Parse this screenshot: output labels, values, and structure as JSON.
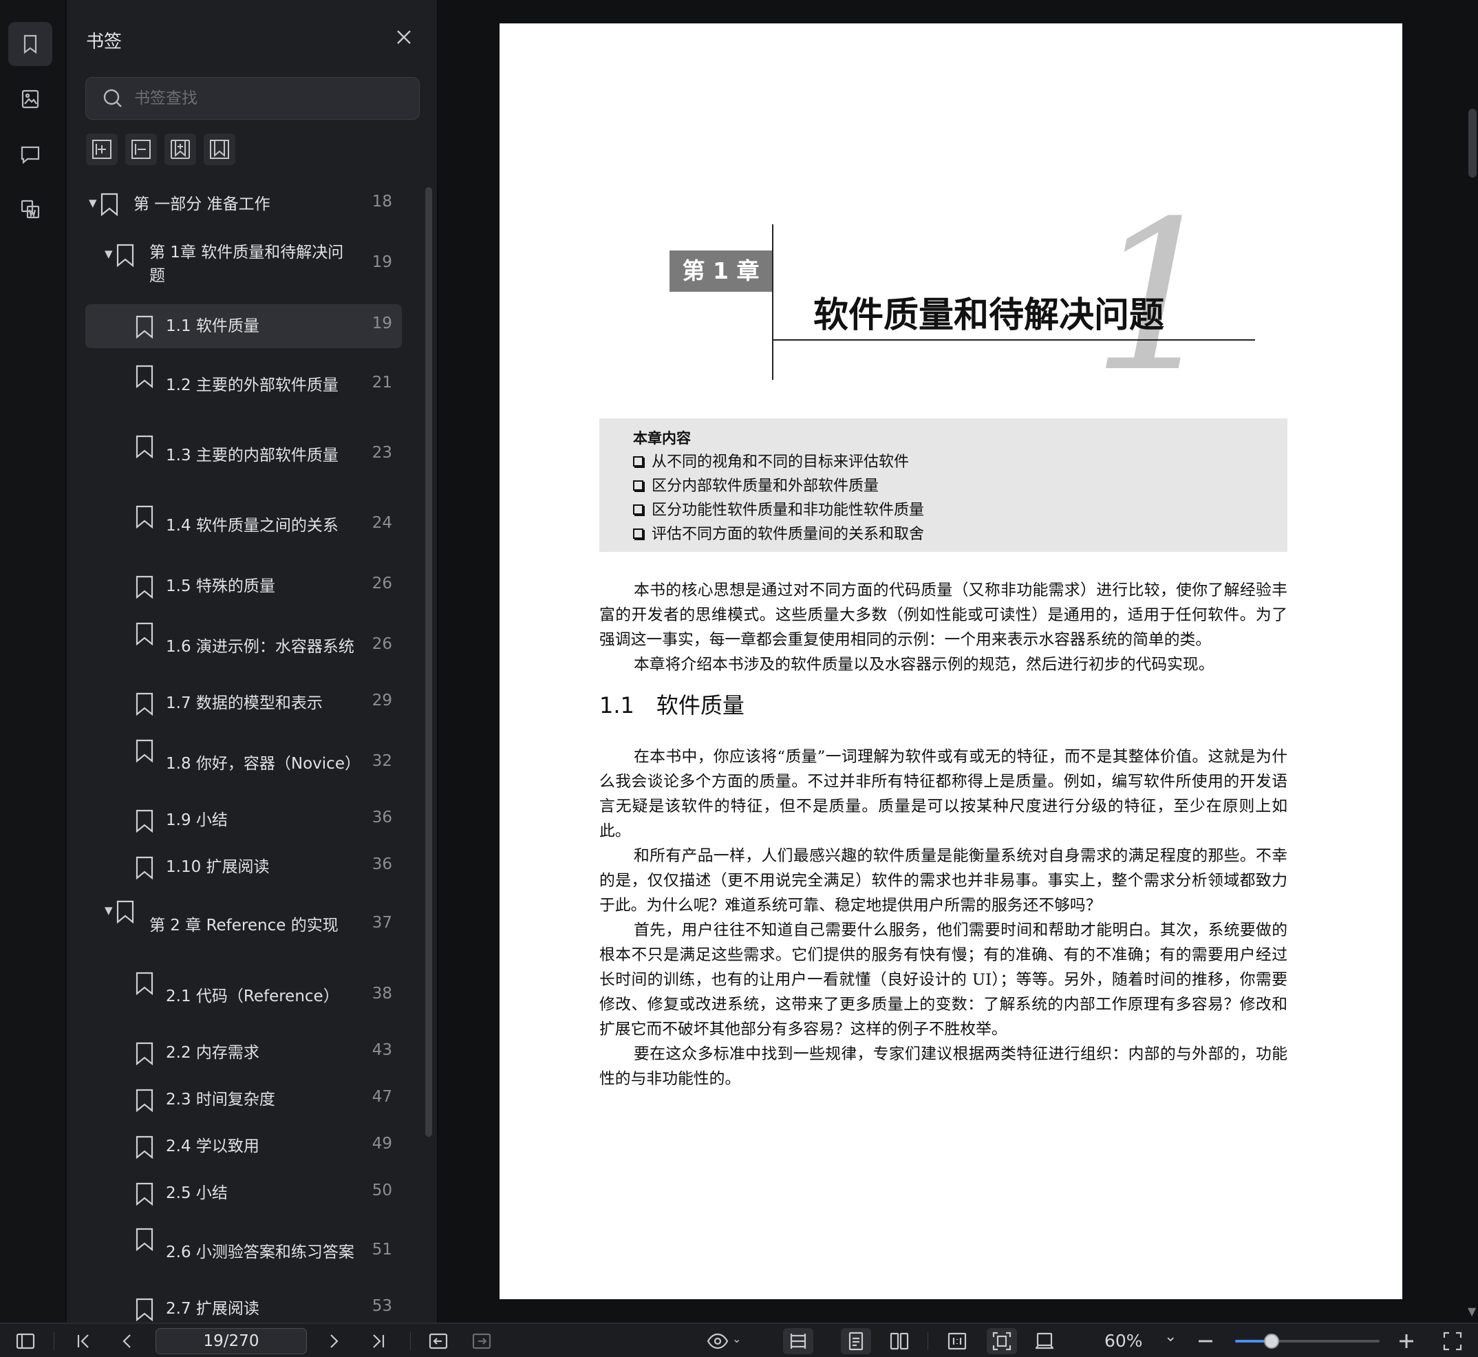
{
  "sidebar": {
    "title": "书签",
    "search_placeholder": "书签查找",
    "rail_icons": [
      "bookmark-icon",
      "image-icon",
      "comment-icon",
      "word-export-icon"
    ],
    "toolbar_icons": [
      "add-bookmark-icon",
      "remove-bookmark-icon",
      "add-child-bookmark-icon",
      "bookmark-icon"
    ],
    "items": [
      {
        "label": "第 一部分 准备工作",
        "page": "18",
        "level": 0,
        "expanded": true
      },
      {
        "label": "第 1章 软件质量和待解决问",
        "label2": "题",
        "page": "19",
        "level": 1,
        "expanded": true
      },
      {
        "label": "1.1 软件质量",
        "page": "19",
        "level": 2,
        "selected": true
      },
      {
        "label": "1.2 主要的外部软件质量",
        "page": "21",
        "level": 2
      },
      {
        "label": "1.3 主要的内部软件质量",
        "page": "23",
        "level": 2
      },
      {
        "label": "1.4 软件质量之间的关系",
        "page": "24",
        "level": 2
      },
      {
        "label": "1.5 特殊的质量",
        "page": "26",
        "level": 2
      },
      {
        "label": "1.6 演进示例：水容器系统",
        "page": "26",
        "level": 2
      },
      {
        "label": "1.7 数据的模型和表示",
        "page": "29",
        "level": 2
      },
      {
        "label": "1.8 你好，容器（Novice）",
        "page": "32",
        "level": 2
      },
      {
        "label": "1.9 小结",
        "page": "36",
        "level": 2
      },
      {
        "label": "1.10 扩展阅读",
        "page": "36",
        "level": 2
      },
      {
        "label": "第 2 章 Reference 的实现",
        "page": "37",
        "level": 1,
        "expanded": true
      },
      {
        "label": "2.1 代码（Reference）",
        "page": "38",
        "level": 2
      },
      {
        "label": "2.2 内存需求",
        "page": "43",
        "level": 2
      },
      {
        "label": "2.3 时间复杂度",
        "page": "47",
        "level": 2
      },
      {
        "label": "2.4 学以致用",
        "page": "49",
        "level": 2
      },
      {
        "label": "2.5 小结",
        "page": "50",
        "level": 2
      },
      {
        "label": "2.6 小测验答案和练习答案",
        "page": "51",
        "level": 2
      },
      {
        "label": "2.7 扩展阅读",
        "page": "53",
        "level": 2
      }
    ]
  },
  "document": {
    "chapter_badge": "第 1 章",
    "chapter_number": "1",
    "chapter_title": "软件质量和待解决问题",
    "contents_heading": "本章内容",
    "contents_items": [
      "从不同的视角和不同的目标来评估软件",
      "区分内部软件质量和外部软件质量",
      "区分功能性软件质量和非功能性软件质量",
      "评估不同方面的软件质量间的关系和取舍"
    ],
    "intro_paragraphs": [
      "本书的核心思想是通过对不同方面的代码质量（又称非功能需求）进行比较，使你了解经验丰富的开发者的思维模式。这些质量大多数（例如性能或可读性）是通用的，适用于任何软件。为了强调这一事实，每一章都会重复使用相同的示例：一个用来表示水容器系统的简单的类。",
      "本章将介绍本书涉及的软件质量以及水容器示例的规范，然后进行初步的代码实现。"
    ],
    "section_number": "1.1",
    "section_title": "软件质量",
    "section_paragraphs": [
      "在本书中，你应该将“质量”一词理解为软件或有或无的特征，而不是其整体价值。这就是为什么我会谈论多个方面的质量。不过并非所有特征都称得上是质量。例如，编写软件所使用的开发语言无疑是该软件的特征，但不是质量。质量是可以按某种尺度进行分级的特征，至少在原则上如此。",
      "和所有产品一样，人们最感兴趣的软件质量是能衡量系统对自身需求的满足程度的那些。不幸的是，仅仅描述（更不用说完全满足）软件的需求也并非易事。事实上，整个需求分析领域都致力于此。为什么呢？难道系统可靠、稳定地提供用户所需的服务还不够吗？",
      "首先，用户往往不知道自己需要什么服务，他们需要时间和帮助才能明白。其次，系统要做的根本不只是满足这些需求。它们提供的服务有快有慢；有的准确、有的不准确；有的需要用户经过长时间的训练，也有的让用户一看就懂（良好设计的 UI）；等等。另外，随着时间的推移，你需要修改、修复或改进系统，这带来了更多质量上的变数：了解系统的内部工作原理有多容易？修改和扩展它而不破坏其他部分有多容易？这样的例子不胜枚举。",
      "要在这众多标准中找到一些规律，专家们建议根据两类特征进行组织：内部的与外部的，功能性的与非功能性的。"
    ]
  },
  "statusbar": {
    "page_indicator": "19/270",
    "zoom_label": "60%",
    "zoom_fraction": 0.25
  }
}
